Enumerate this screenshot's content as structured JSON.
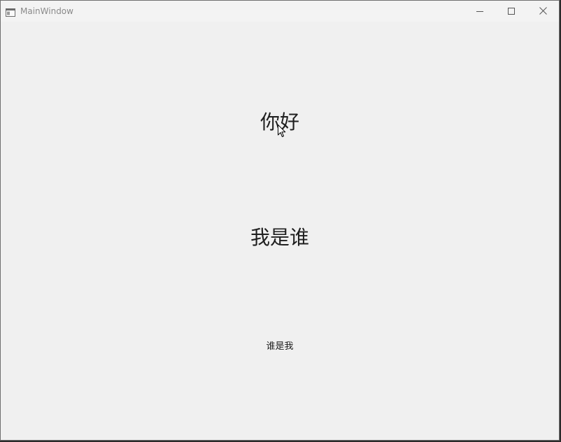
{
  "window": {
    "title": "MainWindow",
    "controls": {
      "minimize_icon": "minimize-icon",
      "maximize_icon": "maximize-icon",
      "close_icon": "close-icon"
    }
  },
  "content": {
    "label_1": "你好",
    "label_2": "我是谁",
    "label_3": "谁是我"
  },
  "colors": {
    "titlebar": "#f3f3f3",
    "client_background": "#f0f0f0",
    "text": "#1f1f1f",
    "title_text": "#8a8a8a"
  }
}
